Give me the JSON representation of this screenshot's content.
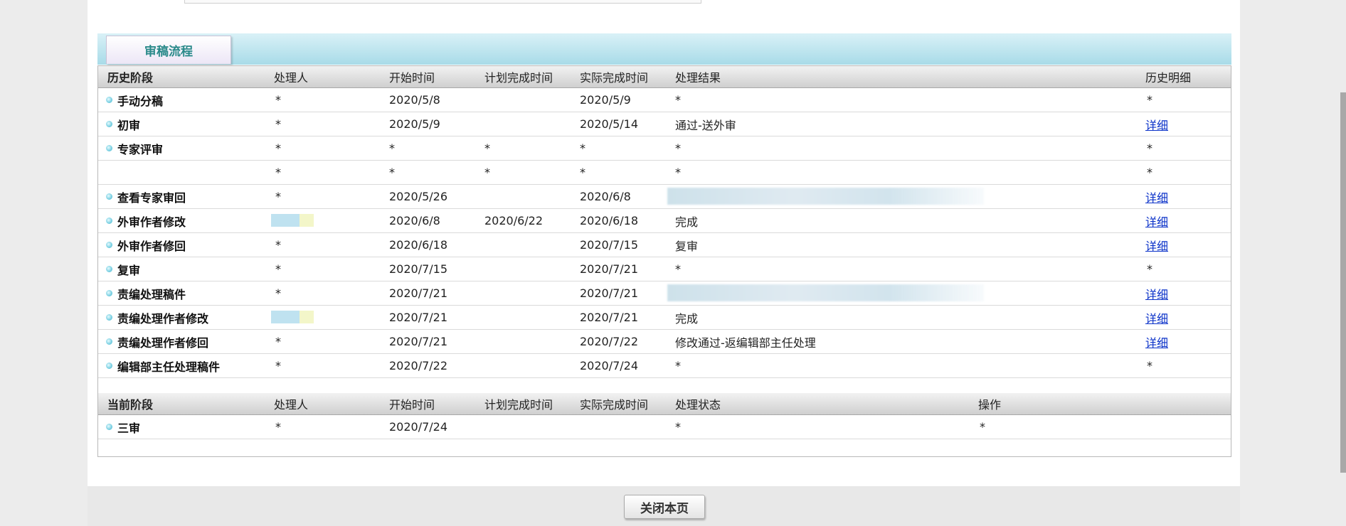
{
  "tab": {
    "label": "审稿流程"
  },
  "history_header": {
    "stage": "历史阶段",
    "handler": "处理人",
    "start": "开始时间",
    "planned": "计划完成时间",
    "actual": "实际完成时间",
    "result": "处理结果",
    "detail": "历史明细"
  },
  "history_rows": [
    {
      "stage": "手动分稿",
      "handler": "*",
      "start": "2020/5/8",
      "planned": "",
      "actual": "2020/5/9",
      "result": "*",
      "detail": "*"
    },
    {
      "stage": "初审",
      "handler": "*",
      "start": "2020/5/9",
      "planned": "",
      "actual": "2020/5/14",
      "result": "通过-送外审",
      "detail": "详细"
    },
    {
      "stage": "专家评审",
      "handler": "*",
      "start": "*",
      "planned": "*",
      "actual": "*",
      "result": "*",
      "detail": "*"
    },
    {
      "stage": "",
      "handler": "*",
      "start": "*",
      "planned": "*",
      "actual": "*",
      "result": "*",
      "detail": "*"
    },
    {
      "stage": "查看专家审回",
      "handler": "*",
      "start": "2020/5/26",
      "planned": "",
      "actual": "2020/6/8",
      "result": "",
      "detail": "详细"
    },
    {
      "stage": "外审作者修改",
      "handler": "",
      "start": "2020/6/8",
      "planned": "2020/6/22",
      "actual": "2020/6/18",
      "result": "完成",
      "detail": "详细"
    },
    {
      "stage": "外审作者修回",
      "handler": "*",
      "start": "2020/6/18",
      "planned": "",
      "actual": "2020/7/15",
      "result": "复审",
      "detail": "详细"
    },
    {
      "stage": "复审",
      "handler": "*",
      "start": "2020/7/15",
      "planned": "",
      "actual": "2020/7/21",
      "result": "*",
      "detail": "*"
    },
    {
      "stage": "责编处理稿件",
      "handler": "*",
      "start": "2020/7/21",
      "planned": "",
      "actual": "2020/7/21",
      "result": "",
      "detail": "详细"
    },
    {
      "stage": "责编处理作者修改",
      "handler": "",
      "start": "2020/7/21",
      "planned": "",
      "actual": "2020/7/21",
      "result": "完成",
      "detail": "详细"
    },
    {
      "stage": "责编处理作者修回",
      "handler": "*",
      "start": "2020/7/21",
      "planned": "",
      "actual": "2020/7/22",
      "result": "修改通过-返编辑部主任处理",
      "detail": "详细"
    },
    {
      "stage": "编辑部主任处理稿件",
      "handler": "*",
      "start": "2020/7/22",
      "planned": "",
      "actual": "2020/7/24",
      "result": "*",
      "detail": "*"
    }
  ],
  "current_header": {
    "stage": "当前阶段",
    "handler": "处理人",
    "start": "开始时间",
    "planned": "计划完成时间",
    "actual": "实际完成时间",
    "status": "处理状态",
    "operation": "操作"
  },
  "current_rows": [
    {
      "stage": "三审",
      "handler": "*",
      "start": "2020/7/24",
      "planned": "",
      "actual": "",
      "status": "*",
      "operation": "*"
    }
  ],
  "close_button": "关闭本页"
}
